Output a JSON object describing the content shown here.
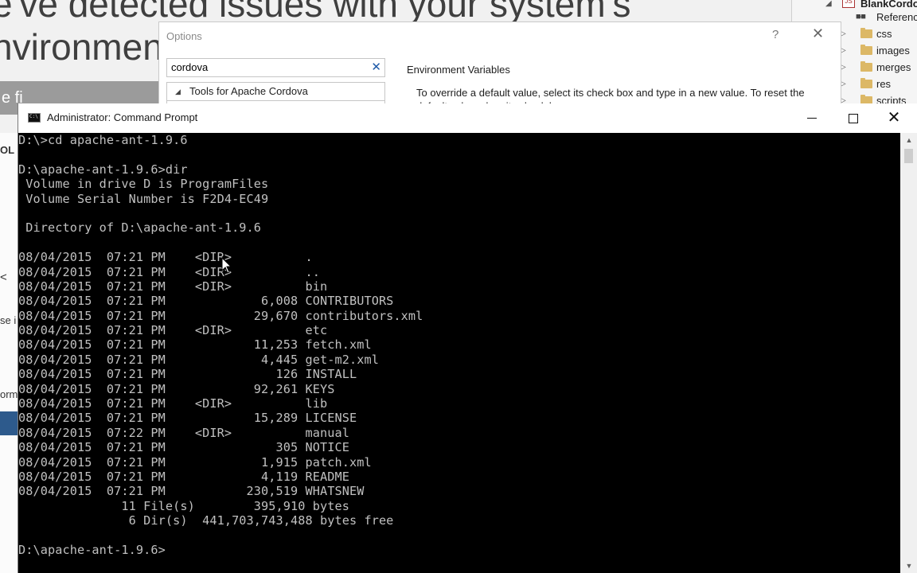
{
  "background": {
    "heading_lines": [
      "e've detected issues with your system's",
      "nvironmen"
    ],
    "strip_text": "e fi",
    "edge_labels": [
      {
        "text": "OL",
        "top": 0
      },
      {
        "text": "<",
        "top": 0
      },
      {
        "text": "se i",
        "top": 0
      },
      {
        "text": "orm",
        "top": 0
      }
    ]
  },
  "solution_explorer": {
    "project_label": "BlankCordo",
    "references_label": "Referenc",
    "folders": [
      "css",
      "images",
      "merges",
      "res",
      "scripts"
    ]
  },
  "options_dialog": {
    "title": "Options",
    "help_glyph": "?",
    "close_glyph": "✕",
    "search_value": "cordova",
    "search_clear_glyph": "✕",
    "tree_item": "Tools for Apache Cordova",
    "section_title": "Environment Variables",
    "description": "To override a default value, select its check box and type in a new value. To reset the default value, clear its check box."
  },
  "cmd_window": {
    "title": "Administrator: Command Prompt",
    "close_glyph": "✕",
    "lines": [
      "D:\\>cd apache-ant-1.9.6",
      "",
      "D:\\apache-ant-1.9.6>dir",
      " Volume in drive D is ProgramFiles",
      " Volume Serial Number is F2D4-EC49",
      "",
      " Directory of D:\\apache-ant-1.9.6",
      "",
      "08/04/2015  07:21 PM    <DIR>          .",
      "08/04/2015  07:21 PM    <DIR>          ..",
      "08/04/2015  07:21 PM    <DIR>          bin",
      "08/04/2015  07:21 PM             6,008 CONTRIBUTORS",
      "08/04/2015  07:21 PM            29,670 contributors.xml",
      "08/04/2015  07:21 PM    <DIR>          etc",
      "08/04/2015  07:21 PM            11,253 fetch.xml",
      "08/04/2015  07:21 PM             4,445 get-m2.xml",
      "08/04/2015  07:21 PM               126 INSTALL",
      "08/04/2015  07:21 PM            92,261 KEYS",
      "08/04/2015  07:21 PM    <DIR>          lib",
      "08/04/2015  07:21 PM            15,289 LICENSE",
      "08/04/2015  07:22 PM    <DIR>          manual",
      "08/04/2015  07:21 PM               305 NOTICE",
      "08/04/2015  07:21 PM             1,915 patch.xml",
      "08/04/2015  07:21 PM             4,119 README",
      "08/04/2015  07:21 PM           230,519 WHATSNEW",
      "              11 File(s)        395,910 bytes",
      "               6 Dir(s)  441,703,743,488 bytes free",
      "",
      "D:\\apache-ant-1.9.6>"
    ]
  }
}
